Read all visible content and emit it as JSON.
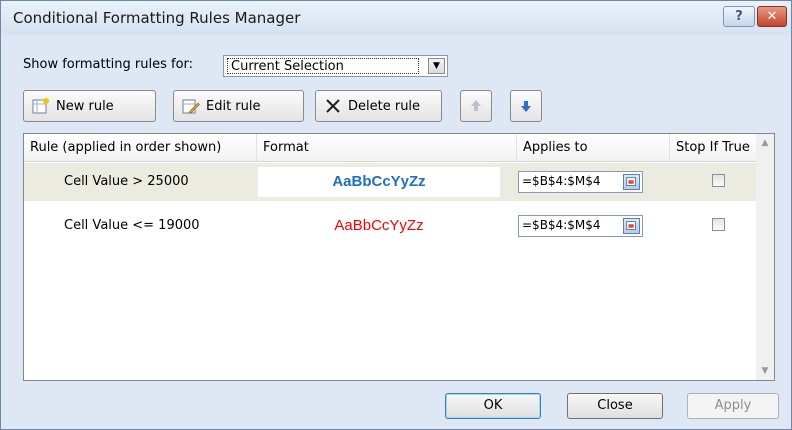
{
  "window": {
    "title": "Conditional Formatting Rules Manager",
    "help_label": "?",
    "close_label": "✕"
  },
  "filter": {
    "label": "Show formatting rules for:",
    "selected": "Current Selection"
  },
  "toolbar": {
    "new_rule": "New rule",
    "edit_rule": "Edit rule",
    "delete_rule": "Delete rule"
  },
  "columns": {
    "rule": "Rule (applied in order shown)",
    "format": "Format",
    "applies_to": "Applies to",
    "stop_if_true": "Stop If True"
  },
  "rules": [
    {
      "condition": "Cell Value > 25000",
      "preview": "AaBbCcYyZz",
      "preview_color": "#1f6fc5",
      "preview_bold": true,
      "applies_to": "=$B$4:$M$4",
      "stop_if_true": false
    },
    {
      "condition": "Cell Value <= 19000",
      "preview": "AaBbCcYyZz",
      "preview_color": "#ff0000",
      "preview_bold": false,
      "applies_to": "=$B$4:$M$4",
      "stop_if_true": false
    }
  ],
  "buttons": {
    "ok": "OK",
    "close": "Close",
    "apply": "Apply"
  },
  "colors": {
    "selected_row": "#ecebe0",
    "dialog_bg": "#dde8f4"
  }
}
